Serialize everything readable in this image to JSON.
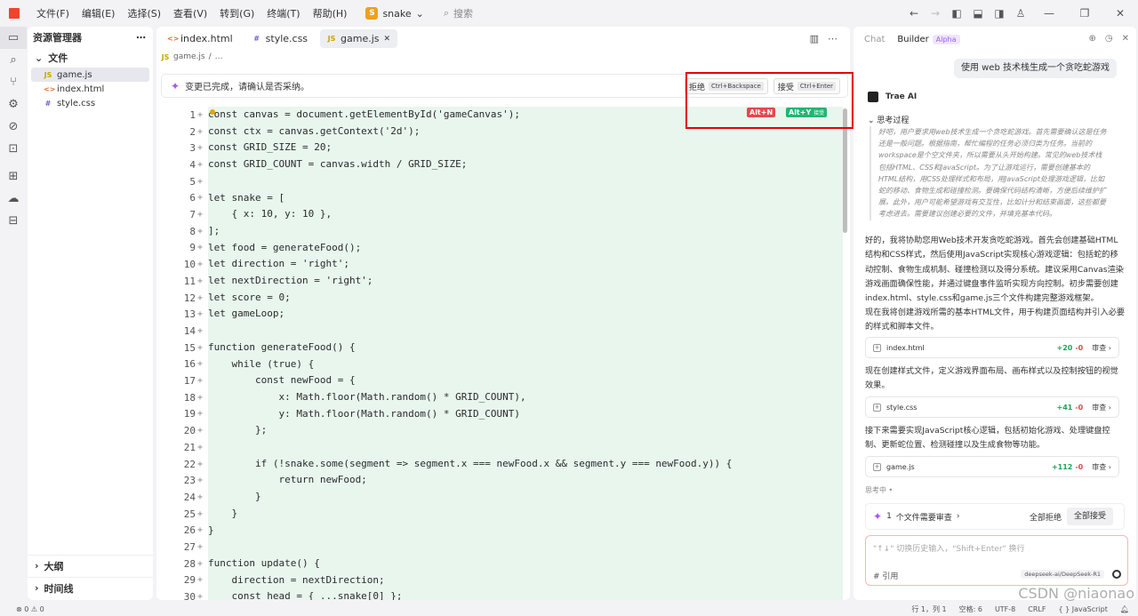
{
  "menu": [
    "文件(F)",
    "编辑(E)",
    "选择(S)",
    "查看(V)",
    "转到(G)",
    "终端(T)",
    "帮助(H)"
  ],
  "project": {
    "badge": "S",
    "name": "snake"
  },
  "search_label": "搜索",
  "explorer": {
    "title": "资源管理器",
    "section": "文件",
    "files": [
      {
        "icon": "JS",
        "name": "game.js",
        "color": "#c9a400"
      },
      {
        "icon": "<>",
        "name": "index.html",
        "color": "#e06c2a"
      },
      {
        "icon": "#",
        "name": "style.css",
        "color": "#7b5cd6"
      }
    ],
    "outline": "大纲",
    "timeline": "时间线"
  },
  "editor": {
    "tabs": [
      {
        "icon": "<>",
        "label": "index.html",
        "color": "#e06c2a"
      },
      {
        "icon": "#",
        "label": "style.css",
        "color": "#7b5cd6"
      },
      {
        "icon": "JS",
        "label": "game.js",
        "color": "#c9a400"
      }
    ],
    "breadcrumb_icon": "JS",
    "breadcrumb": "game.js",
    "breadcrumb_more": "…",
    "banner_text": "变更已完成，请确认是否采纳。",
    "reject_label": "拒绝",
    "reject_kbd": "Ctrl+Backspace",
    "accept_label": "接受",
    "accept_kbd": "Ctrl+Enter",
    "tag_reject": "Alt+N",
    "tag_accept": "Alt+Y",
    "tag_accept_sub": "接受",
    "lines": [
      "const canvas = document.getElementById('gameCanvas');",
      "const ctx = canvas.getContext('2d');",
      "const GRID_SIZE = 20;",
      "const GRID_COUNT = canvas.width / GRID_SIZE;",
      "",
      "let snake = [",
      "    { x: 10, y: 10 },",
      "];",
      "let food = generateFood();",
      "let direction = 'right';",
      "let nextDirection = 'right';",
      "let score = 0;",
      "let gameLoop;",
      "",
      "function generateFood() {",
      "    while (true) {",
      "        const newFood = {",
      "            x: Math.floor(Math.random() * GRID_COUNT),",
      "            y: Math.floor(Math.random() * GRID_COUNT)",
      "        };",
      "",
      "        if (!snake.some(segment => segment.x === newFood.x && segment.y === newFood.y)) {",
      "            return newFood;",
      "        }",
      "    }",
      "}",
      "",
      "function update() {",
      "    direction = nextDirection;",
      "    const head = { ...snake[0] };"
    ]
  },
  "chat": {
    "tab_chat": "Chat",
    "tab_builder": "Builder",
    "tab_alpha": "Alpha",
    "user_message": "使用 web 技术栈生成一个贪吃蛇游戏",
    "bot_name": "Trae AI",
    "thinking_header": "思考过程",
    "thinking_text": "好吧，用户要求用web技术生成一个贪吃蛇游戏。首先需要确认这是任务还是一般问题。根据指南，帮忙编程的任务必须归类为任务。当前的workspace是个空文件夹，所以需要从头开始构建。常见的web技术栈包括HTML、CSS和JavaScript。为了让游戏运行，需要创建基本的HTML结构，用CSS处理样式和布局，用JavaScript处理游戏逻辑，比如蛇的移动、食物生成和碰撞检测。要确保代码结构清晰，方便后续维护扩展。此外，用户可能希望游戏有交互性，比如计分和结束画面，这些都要考虑进去。需要建议创建必要的文件，并填充基本代码。",
    "paragraph1": "好的，我将协助您用Web技术开发贪吃蛇游戏。首先会创建基础HTML结构和CSS样式，然后使用JavaScript实现核心游戏逻辑：包括蛇的移动控制、食物生成机制、碰撞检测以及得分系统。建议采用Canvas渲染游戏画面确保性能，并通过键盘事件监听实现方向控制。初步需要创建index.html、style.css和game.js三个文件构建完整游戏框架。",
    "paragraph2": "现在我将创建游戏所需的基本HTML文件，用于构建页面结构并引入必要的样式和脚本文件。",
    "paragraph3": "现在创建样式文件，定义游戏界面布局、画布样式以及控制按钮的视觉效果。",
    "paragraph4": "接下来需要实现JavaScript核心逻辑，包括初始化游戏、处理键盘控制、更新蛇位置、检测碰撞以及生成食物等功能。",
    "files": [
      {
        "name": "index.html",
        "adds": "+20",
        "dels": "-0",
        "review": "审查"
      },
      {
        "name": "style.css",
        "adds": "+41",
        "dels": "-0",
        "review": "审查"
      },
      {
        "name": "game.js",
        "adds": "+112",
        "dels": "-0",
        "review": "审查"
      }
    ],
    "thinking_status": "思考中 •",
    "pending_count": "1",
    "pending_text": "个文件需要审查",
    "reject_all": "全部拒绝",
    "accept_all": "全部接受",
    "input_placeholder": "\"↑↓\" 切换历史输入，\"Shift+Enter\" 换行",
    "ref_label": "# 引用",
    "model": "deepseek-ai/DeepSeek-R1"
  },
  "status": {
    "problems": "⊗ 0 ⚠ 0",
    "position": "行 1，列 1",
    "spaces": "空格: 6",
    "encoding": "UTF-8",
    "eol": "CRLF",
    "language": "{ } JavaScript"
  },
  "watermark": "CSDN @niaonao"
}
